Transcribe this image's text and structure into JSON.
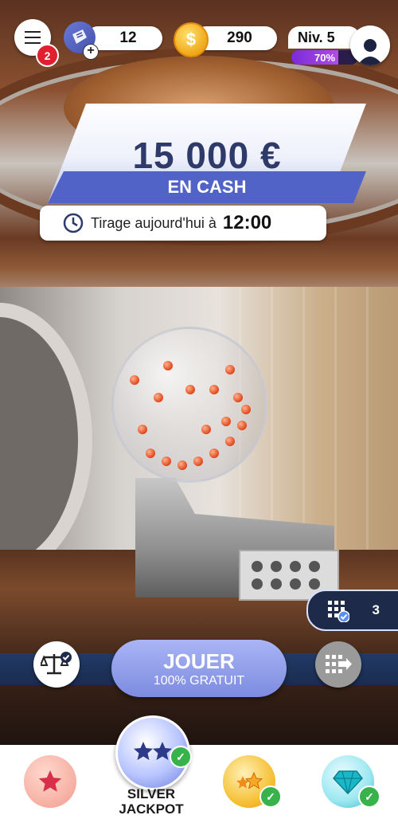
{
  "topbar": {
    "menu_badge": "2",
    "tickets": "12",
    "coins": "290",
    "level_label": "Niv. 5",
    "level_progress": "70%",
    "level_fraction": 0.7,
    "icons": {
      "menu": "hamburger-icon",
      "tickets": "ticket-icon",
      "coins": "dollar-coin-icon",
      "profile": "user-avatar-icon",
      "add": "plus-icon"
    }
  },
  "prize": {
    "amount": "15 000 €",
    "subtitle": "EN CASH",
    "draw_label": "Tirage aujourd'hui à",
    "draw_time": "12:00"
  },
  "grids": {
    "count": "3"
  },
  "play": {
    "label": "JOUER",
    "sub": "100% GRATUIT"
  },
  "bottom_nav": {
    "active_label": "SILVER\nJACKPOT",
    "items": [
      "star-bubble",
      "silver-jackpot",
      "gold-stars",
      "diamond"
    ]
  },
  "colors": {
    "primary": "#5263c7",
    "navy": "#2d3a6a",
    "badge_red": "#e0202e",
    "check_green": "#38b24a",
    "level_purple": "#7a2bd8"
  }
}
